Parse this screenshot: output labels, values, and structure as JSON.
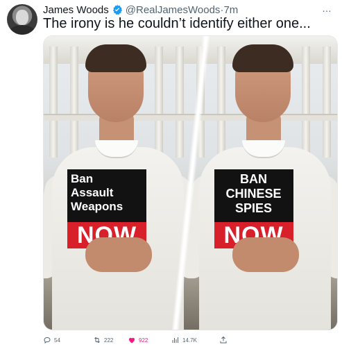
{
  "author": {
    "name": "James Woods",
    "handle": "@RealJamesWoods",
    "separator": "·",
    "time": "7m"
  },
  "tweet": {
    "text": "The irony is he couldn’t identify either one..."
  },
  "media": {
    "left_sign": {
      "lines": [
        "Ban",
        "Assault",
        "Weapons"
      ],
      "bottom": "NOW"
    },
    "right_sign": {
      "lines": [
        "BAN",
        "CHINESE",
        "SPIES"
      ],
      "bottom": "NOW"
    }
  },
  "actions": {
    "replies": "54",
    "retweets": "222",
    "likes": "922",
    "views": "14.7K"
  },
  "colors": {
    "like_pink": "#f91880",
    "verified_blue": "#1d9bf0",
    "sign_red": "#d8202a",
    "secondary_text": "#536471"
  }
}
